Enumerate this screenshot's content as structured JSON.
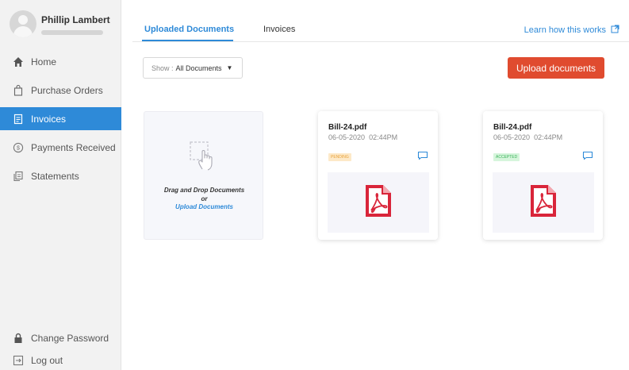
{
  "user": {
    "name": "Phillip Lambert"
  },
  "sidebar": {
    "items": [
      {
        "label": "Home",
        "icon": "home-icon"
      },
      {
        "label": "Purchase Orders",
        "icon": "shopping-bag-icon"
      },
      {
        "label": "Invoices",
        "icon": "invoice-icon",
        "active": true
      },
      {
        "label": "Payments Received",
        "icon": "dollar-circle-icon"
      },
      {
        "label": "Statements",
        "icon": "statement-icon"
      }
    ],
    "bottom": [
      {
        "label": "Change Password",
        "icon": "lock-icon"
      },
      {
        "label": "Log out",
        "icon": "logout-icon"
      }
    ]
  },
  "tabs": [
    {
      "label": "Uploaded Documents",
      "active": true
    },
    {
      "label": "Invoices",
      "active": false
    }
  ],
  "learn_link": {
    "label": "Learn how this works",
    "icon": "external-link-icon"
  },
  "filter": {
    "prefix": "Show :",
    "value": "All Documents"
  },
  "upload_button": {
    "label": "Upload documents"
  },
  "dropzone": {
    "icon": "drag-drop-hand-icon",
    "line1": "Drag and Drop Documents",
    "line2": "or",
    "link": "Upload Documents"
  },
  "documents": [
    {
      "name": "Bill-24.pdf",
      "date": "06-05-2020",
      "time": "02:44PM",
      "status": "PENDING",
      "status_color": "#e8a23a",
      "icon": "pdf-icon"
    },
    {
      "name": "Bill-24.pdf",
      "date": "06-05-2020",
      "time": "02:44PM",
      "status": "ACCEPTED",
      "status_color": "#3bb35a",
      "icon": "pdf-icon"
    }
  ],
  "colors": {
    "accent": "#2e8ad8",
    "upload": "#e04b2f",
    "pdf": "#d9253a"
  }
}
